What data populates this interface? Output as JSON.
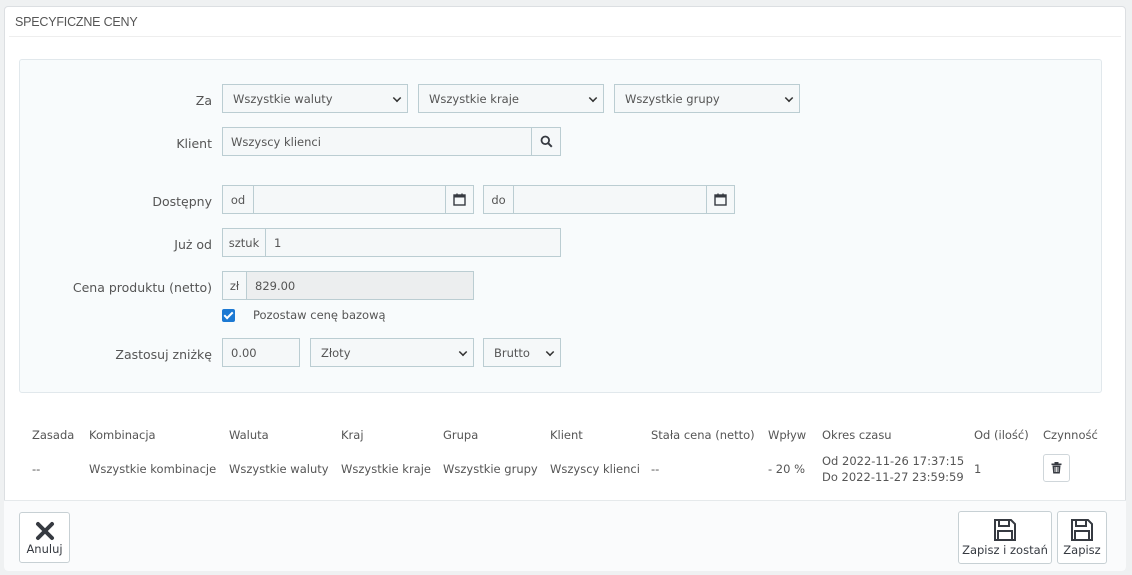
{
  "panel": {
    "title": "SPECYFICZNE CENY"
  },
  "form": {
    "za_label": "Za",
    "currency_select": "Wszystkie waluty",
    "country_select": "Wszystkie kraje",
    "group_select": "Wszystkie grupy",
    "klient_label": "Klient",
    "klient_value": "Wszyscy klienci",
    "dostepny_label": "Dostępny",
    "from_addon": "od",
    "to_addon": "do",
    "from_value": "",
    "to_value": "",
    "juz_od_label": "Już od",
    "units_addon": "sztuk",
    "units_value": "1",
    "price_label": "Cena produktu (netto)",
    "price_currency": "zł",
    "price_value": "829.00",
    "keep_base_label": "Pozostaw cenę bazową",
    "keep_base_checked": true,
    "discount_label": "Zastosuj zniżkę",
    "discount_value": "0.00",
    "discount_type": "Złoty",
    "discount_tax": "Brutto"
  },
  "table": {
    "headers": [
      "Zasada",
      "Kombinacja",
      "Waluta",
      "Kraj",
      "Grupa",
      "Klient",
      "Stała cena (netto)",
      "Wpływ",
      "Okres czasu",
      "Od (ilość)",
      "Czynność"
    ],
    "rows": [
      {
        "zasada": "--",
        "kombinacja": "Wszystkie kombinacje",
        "waluta": "Wszystkie waluty",
        "kraj": "Wszystkie kraje",
        "grupa": "Wszystkie grupy",
        "klient": "Wszyscy klienci",
        "stala_cena": "--",
        "wplyw": "- 20 %",
        "okres_od": "Od 2022-11-26 17:37:15",
        "okres_do": "Do 2022-11-27 23:59:59",
        "od_ilosc": "1"
      }
    ]
  },
  "footer": {
    "cancel_label": "Anuluj",
    "save_stay_label": "Zapisz i zostań",
    "save_label": "Zapisz"
  },
  "icons": {
    "search": "search-icon",
    "calendar": "calendar-icon",
    "trash": "trash-icon",
    "close": "close-icon",
    "save": "floppy-disk-icon"
  },
  "colors": {
    "checkbox": "#1c79d3",
    "border": "#bbcdd2"
  }
}
